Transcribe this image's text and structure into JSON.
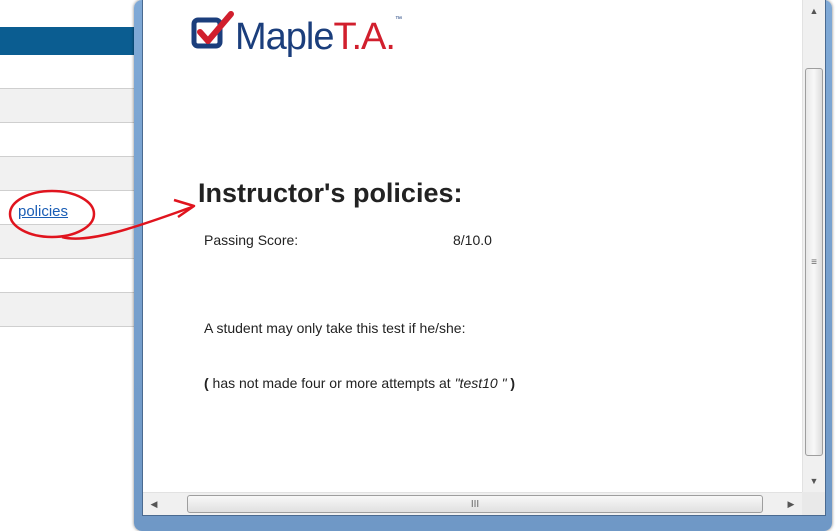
{
  "background": {
    "link_text": "policies",
    "header_color": "#0b5d91"
  },
  "window": {
    "logo": {
      "name": "Maple",
      "suffix": "T.A.",
      "tm": "™"
    },
    "heading": "Instructor's policies:",
    "passing_score": {
      "label": "Passing Score:",
      "value": "8/10.0"
    },
    "eligibility_intro": "A student may only take this test if he/she:",
    "condition": {
      "open": "(",
      "text": " has not made four or more attempts at ",
      "test_name": "\"test10 \"",
      "close": " )"
    },
    "scroll_grip": "≡",
    "hscroll_grip": "III"
  },
  "colors": {
    "accent": "#1b3e7c",
    "brand_red": "#d11f2d",
    "annotation": "#e0141e"
  }
}
